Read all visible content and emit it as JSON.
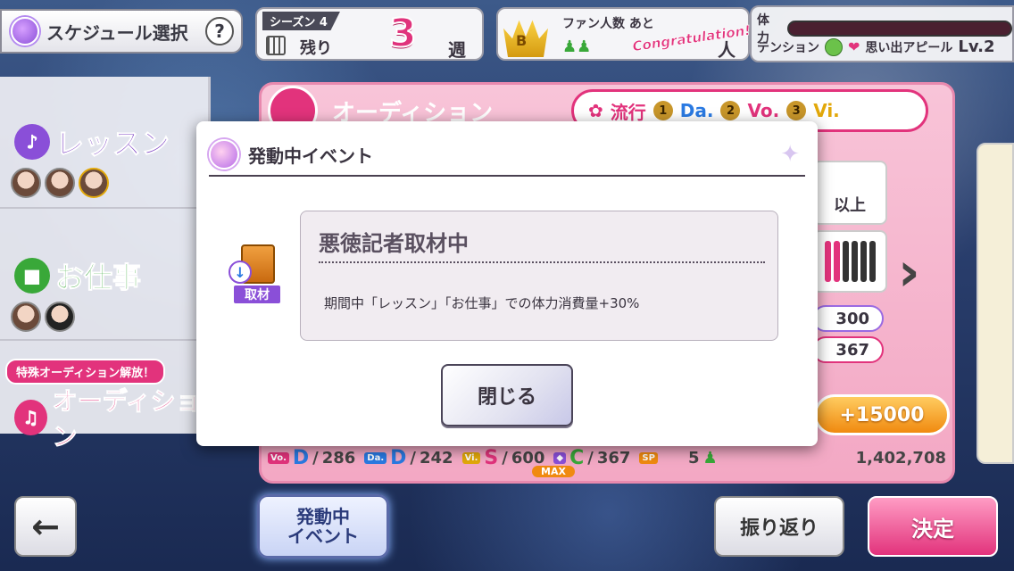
{
  "header": {
    "schedule_label": "スケジュール選択",
    "help_icon": "?",
    "season_label": "シーズン 4",
    "remaining_label": "残り",
    "weeks_remaining": "3",
    "weeks_unit": "週",
    "fan_label": "ファン人数 あと",
    "fan_rank": "B",
    "congrats": "Congratulation!",
    "fan_unit": "人",
    "stamina_label": "体力",
    "tension_label": "テンション",
    "appeal_label": "思い出アピール",
    "appeal_level": "Lv.2"
  },
  "left_menu": {
    "lesson": "レッスン",
    "work": "お仕事",
    "special_badge": "特殊オーディション解放！",
    "audition": "オーディション"
  },
  "audition_panel": {
    "title": "オーディション",
    "trend_label": "流行",
    "trend": [
      {
        "rank": "1",
        "attr": "Da."
      },
      {
        "rank": "2",
        "attr": "Vo."
      },
      {
        "rank": "3",
        "attr": "Vi."
      }
    ],
    "condition_text": "以上",
    "value1": "300",
    "value2": "367",
    "bonus": "+15000"
  },
  "stats": {
    "vo_grade": "D",
    "vo_value": "286",
    "da_grade": "D",
    "da_value": "242",
    "vi_grade": "S",
    "vi_value": "600",
    "me_grade": "C",
    "me_value": "367",
    "sp_value": "5",
    "fans": "1,402,708",
    "max_label": "MAX"
  },
  "bottom": {
    "back_icon": "←",
    "event_button": "発動中\nイベント",
    "review_button": "振り返り",
    "decide_button": "決定"
  },
  "dialog": {
    "title": "発動中イベント",
    "badge_label": "取材",
    "event_name": "悪徳記者取材中",
    "event_desc": "期間中「レッスン」「お仕事」での体力消費量+30%",
    "close_button": "閉じる"
  }
}
